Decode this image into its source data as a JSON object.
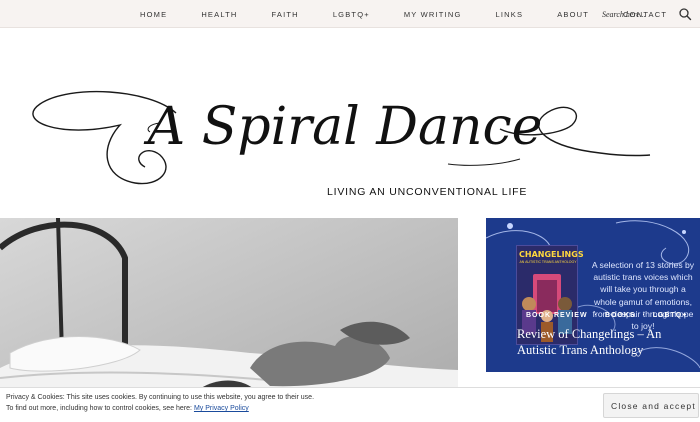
{
  "nav": {
    "items": [
      "HOME",
      "HEALTH",
      "FAITH",
      "LGBTQ+",
      "MY WRITING",
      "LINKS",
      "ABOUT",
      "CONTACT"
    ],
    "search_placeholder": "Search here..."
  },
  "header": {
    "title": "A Spiral Dance",
    "tagline": "LIVING AN UNCONVENTIONAL LIFE"
  },
  "featured": {
    "book_title": "CHANGELINGS",
    "book_subtitle": "AN AUTISTIC TRANS ANTHOLOGY",
    "blurb": "A selection of 13 stories by autistic trans voices which will take you through a whole gamut of emotions, from despair through hope to joy!",
    "categories": [
      "BOOK REVIEW",
      "BOOKS",
      "LGBTQ+"
    ],
    "separator": "·",
    "title": "Review of Changelings – An Autistic Trans Anthology"
  },
  "cookie": {
    "line1": "Privacy & Cookies: This site uses cookies. By continuing to use this website, you agree to their use.",
    "line2": "To find out more, including how to control cookies, see here:",
    "link": "My Privacy Policy",
    "button": "Close and accept"
  },
  "colors": {
    "card_bg": "#1d3a8c",
    "topbar_bg": "#f7f3f1"
  }
}
